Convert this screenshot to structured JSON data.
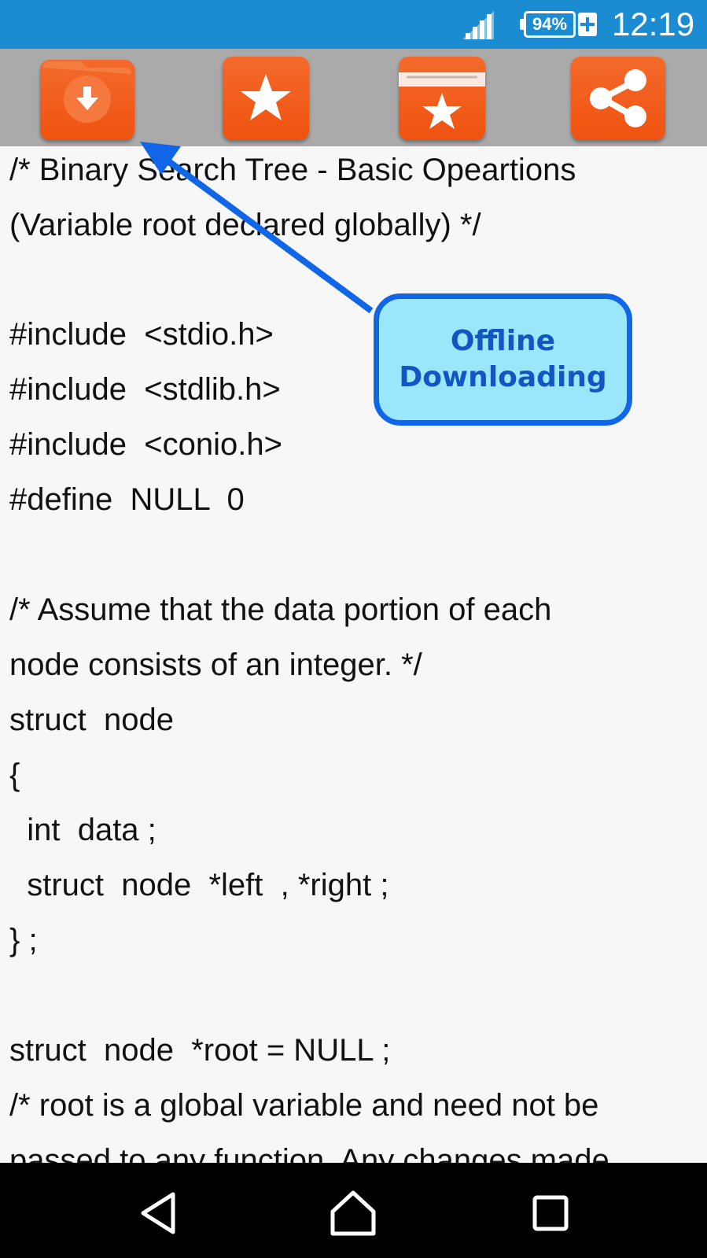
{
  "status_bar": {
    "battery": "94%",
    "time": "12:19"
  },
  "toolbar": {
    "buttons": [
      {
        "name": "download-folder",
        "icon": "download-icon"
      },
      {
        "name": "favorite",
        "icon": "star-icon"
      },
      {
        "name": "favorites-folder",
        "icon": "folder-star-icon"
      },
      {
        "name": "share",
        "icon": "share-icon"
      }
    ],
    "accent": "#f0520f"
  },
  "content": {
    "lines": [
      "/* Binary Search Tree - Basic Opeartions",
      "(Variable root declared globally) */",
      "",
      "#include  <stdio.h>",
      "#include  <stdlib.h>",
      "#include  <conio.h>",
      "#define  NULL  0",
      "",
      "/* Assume that the data portion of each",
      "node consists of an integer. */",
      "struct  node",
      "{",
      "  int  data ;",
      "  struct  node  *left  , *right ;",
      "} ;",
      "",
      "struct  node  *root = NULL ;",
      "/* root is a global variable and need not be",
      "passed to any function. Any changes made"
    ]
  },
  "callout": {
    "line1": "Offline",
    "line2": "Downloading"
  },
  "nav_bar": {
    "buttons": [
      "back-icon",
      "home-icon",
      "recents-icon"
    ]
  }
}
